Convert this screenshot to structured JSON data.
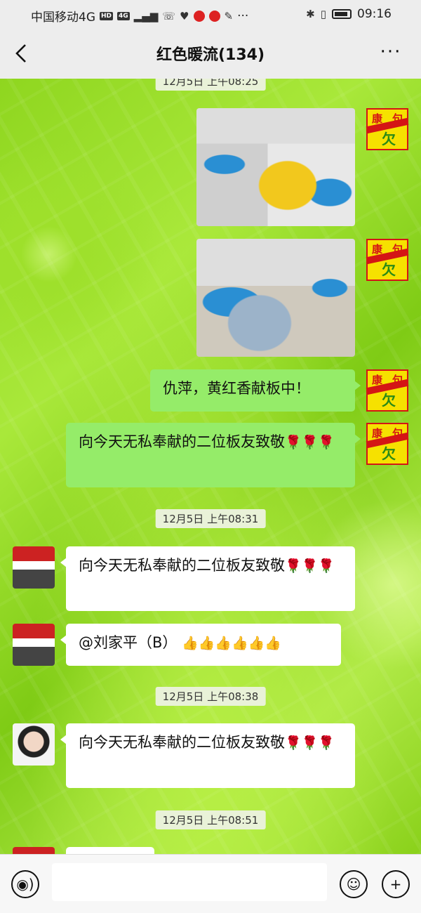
{
  "status_bar": {
    "carrier": "中国移动4G",
    "hd_badge": "HD",
    "network_badge": "4G",
    "time": "09:16",
    "dots": "···"
  },
  "header": {
    "title": "红色暖流(134)",
    "more_label": "···"
  },
  "messages": {
    "timestamp_1": "12月5日 上午08:25",
    "msg_1_text": "仇萍，黄红香献板中！",
    "msg_2_text": "向今天无私奉献的二位板友致敬",
    "msg_2_emoji": "🌹🌹🌹",
    "timestamp_2": "12月5日 上午08:31",
    "msg_3_text": "向今天无私奉献的二位板友致敬",
    "msg_3_emoji": "🌹🌹🌹",
    "msg_4_text": "@刘家平（B）",
    "msg_4_emoji": "👍👍👍👍👍👍",
    "timestamp_3": "12月5日 上午08:38",
    "msg_5_text": "向今天无私奉献的二位板友致敬",
    "msg_5_emoji": "🌹🌹🌹",
    "timestamp_4": "12月5日 上午08:51"
  },
  "avatars": {
    "kang_top_left": "康",
    "kang_top_right": "句",
    "kang_bottom": "欠"
  },
  "input_bar": {
    "text_value": ""
  },
  "icons": {
    "back": "back-arrow-icon",
    "more": "more-icon",
    "voice": "voice-icon",
    "emoji": "emoji-icon",
    "plus": "plus-icon"
  },
  "colors": {
    "sent_bubble": "#95ec69",
    "received_bubble": "#ffffff",
    "chat_background": "#9ee02b"
  }
}
